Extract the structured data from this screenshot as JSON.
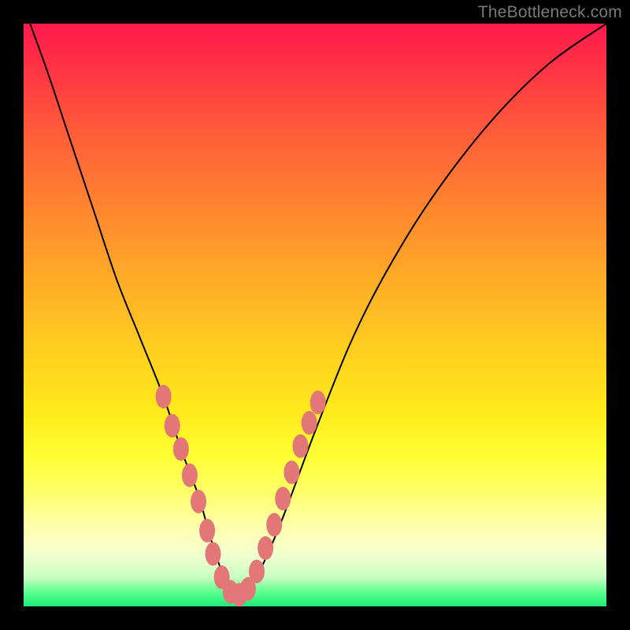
{
  "watermark": "TheBottleneck.com",
  "chart_data": {
    "type": "line",
    "title": "",
    "xlabel": "",
    "ylabel": "",
    "xlim": [
      0,
      100
    ],
    "ylim": [
      0,
      100
    ],
    "grid": false,
    "background_gradient": {
      "top": "#ff1a4d",
      "mid": "#ffe81a",
      "bottom": "#20e87a"
    },
    "series": [
      {
        "name": "bottleneck-curve",
        "color": "#000000",
        "x": [
          0,
          4,
          8,
          12,
          16,
          20,
          24,
          27,
          30,
          32,
          34,
          36,
          38,
          40,
          44,
          50,
          56,
          62,
          70,
          80,
          90,
          100
        ],
        "values": [
          103,
          92,
          80,
          68,
          56,
          46,
          36,
          27,
          19,
          12,
          6,
          2,
          2,
          5,
          14,
          30,
          45,
          57,
          70,
          83,
          93,
          100
        ]
      }
    ],
    "dots": {
      "name": "highlighted-points",
      "color": "#e37777",
      "x": [
        24.0,
        25.5,
        27.0,
        28.5,
        30.0,
        31.5,
        32.5,
        34.0,
        35.5,
        37.0,
        38.5,
        40.0,
        41.5,
        43.0,
        44.5,
        46.0,
        47.5,
        49.0,
        50.5
      ],
      "values": [
        36.0,
        31.0,
        27.0,
        22.5,
        18.0,
        13.0,
        9.0,
        5.0,
        2.5,
        2.0,
        3.0,
        6.0,
        10.0,
        14.0,
        18.5,
        23.0,
        27.5,
        31.5,
        35.0
      ]
    }
  }
}
